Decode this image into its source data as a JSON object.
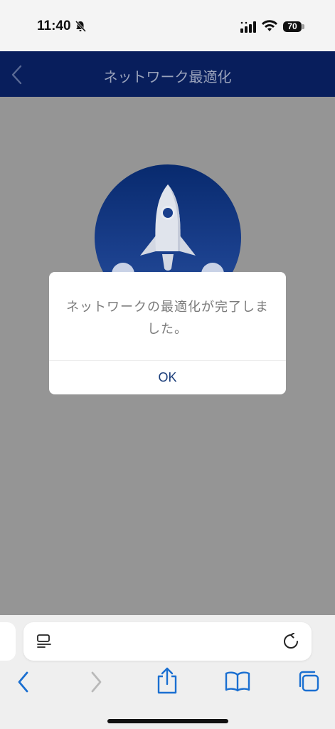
{
  "status_bar": {
    "time": "11:40",
    "battery_level": "70"
  },
  "header": {
    "title": "ネットワーク最適化"
  },
  "dialog": {
    "message": "ネットワークの最適化が完了しました。",
    "ok_label": "OK"
  },
  "icons": {
    "status": [
      "bell-slash-icon",
      "cellular-signal-icon",
      "wifi-icon",
      "battery-icon"
    ],
    "header": [
      "back-chevron-icon"
    ],
    "content": [
      "rocket-icon"
    ],
    "address_bar": [
      "reader-mode-icon",
      "reload-icon"
    ],
    "toolbar": [
      "back-icon",
      "forward-icon",
      "share-icon",
      "bookmarks-icon",
      "tabs-icon"
    ]
  },
  "colors": {
    "header_bg": "#081e5c",
    "overlay_bg": "#959595",
    "accent": "#1a6fd1",
    "ok_text": "#1a3d7a"
  }
}
